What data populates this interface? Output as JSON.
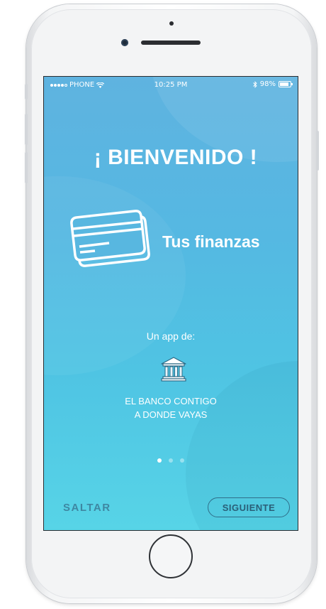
{
  "status_bar": {
    "carrier": "PHONE",
    "time": "10:25 PM",
    "battery": "98%"
  },
  "onboarding": {
    "welcome": "¡ BIENVENIDO !",
    "feature_text": "Tus finanzas",
    "feature_icon": "credit-cards-icon",
    "app_by_label": "Un app de:",
    "bank_icon": "bank-icon",
    "bank_name_line1": "EL BANCO CONTIGO",
    "bank_name_line2": "A DONDE VAYAS",
    "page_count": 3,
    "current_page": 1
  },
  "actions": {
    "skip_label": "SALTAR",
    "next_label": "SIGUIENTE"
  },
  "colors": {
    "screen_top": "#5fb3e0",
    "screen_bottom": "#57d4e7",
    "button_accent": "#2f6e8a"
  }
}
